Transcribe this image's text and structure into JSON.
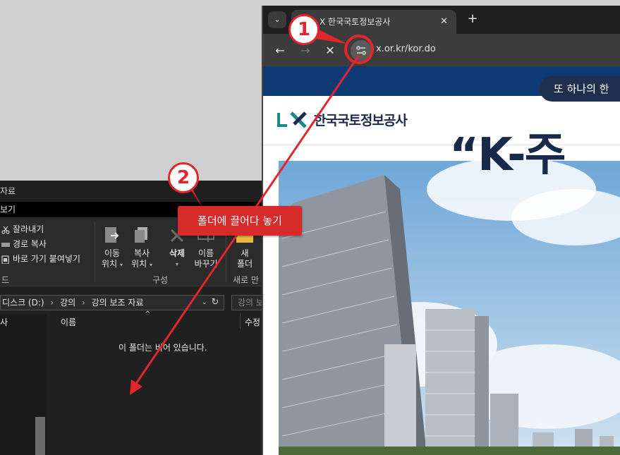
{
  "explorer": {
    "title": "자료",
    "menubar": "보기",
    "ribbon": {
      "cut": "잘라내기",
      "copy_path": "경로 복사",
      "paste_shortcut": "바로 가기 붙여넣기",
      "move_to_line1": "이동",
      "move_to_line2": "위치",
      "copy_to_line1": "복사",
      "copy_to_line2": "위치",
      "delete": "삭제",
      "rename_line1": "이름",
      "rename_line2": "바꾸기",
      "new_folder_line1": "새",
      "new_folder_line2": "폴더",
      "group_left": "드",
      "group_organize": "구성",
      "group_new": "새로 만"
    },
    "address": {
      "segments": [
        "디스크 (D:)",
        "강의",
        "강의 보조 자료"
      ],
      "separator": "›"
    },
    "search_placeholder": "강의 보",
    "columns": {
      "nav_header": "사",
      "name": "이름",
      "modified": "수정"
    },
    "empty_message": "이 폴더는 비어 있습니다."
  },
  "browser": {
    "tab_title": "X 한국국토정보공사",
    "url": "x.or.kr/kor.do",
    "site": {
      "logo_text": "한국국토정보공사",
      "pill_text": "또 하나의 한",
      "headline": "“K-주"
    }
  },
  "annotations": {
    "badge1": "1",
    "badge2": "2",
    "callout": "폴더에 끌어다 놓기",
    "accent_color": "#e1262d"
  }
}
